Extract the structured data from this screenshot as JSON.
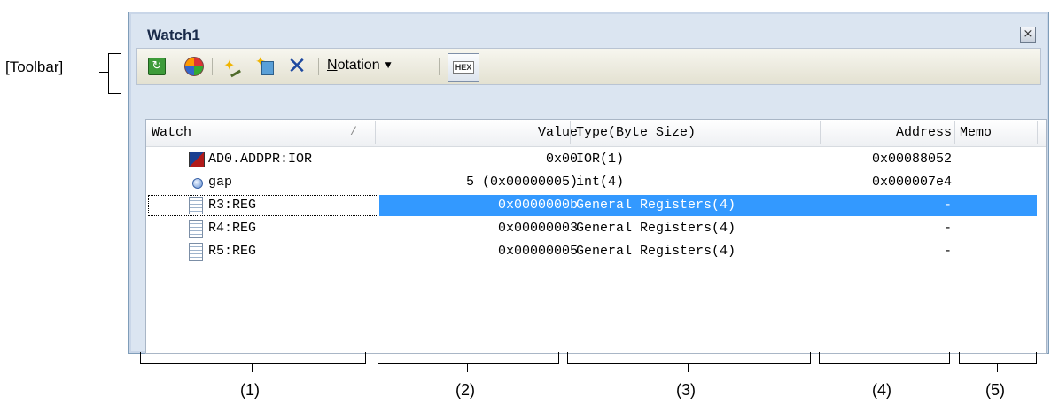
{
  "annotations": {
    "toolbar_label": "[Toolbar]",
    "column_labels": [
      "(1)",
      "(2)",
      "(3)",
      "(4)",
      "(5)"
    ]
  },
  "window": {
    "title": "Watch1",
    "close_icon": "close-icon"
  },
  "toolbar": {
    "buttons": [
      "refresh-icon",
      "color-icon",
      "add-watch-icon",
      "add-category-icon",
      "delete-icon"
    ],
    "notation_label": "Notation",
    "notation_accel": "N",
    "notation_rest": "otation",
    "hex_label": "HEX"
  },
  "table": {
    "columns": [
      "Watch",
      "Value",
      "Type(Byte Size)",
      "Address",
      "Memo"
    ],
    "sort_indicator": "/",
    "rows": [
      {
        "icon": "ior-icon",
        "watch": "AD0.ADDPR:IOR",
        "value": "0x00",
        "type": "IOR(1)",
        "address": "0x00088052",
        "memo": ""
      },
      {
        "icon": "variable-icon",
        "watch": "gap",
        "value": "5 (0x00000005)",
        "type": "int(4)",
        "address": "0x000007e4",
        "memo": ""
      },
      {
        "icon": "register-icon",
        "watch": "R3:REG",
        "value": "0x0000000b",
        "type": "General Registers(4)",
        "address": "-",
        "memo": ""
      },
      {
        "icon": "register-icon",
        "watch": "R4:REG",
        "value": "0x00000003",
        "type": "General Registers(4)",
        "address": "-",
        "memo": ""
      },
      {
        "icon": "register-icon",
        "watch": "R5:REG",
        "value": "0x00000005",
        "type": "General Registers(4)",
        "address": "-",
        "memo": ""
      }
    ],
    "selected_row": 2
  }
}
